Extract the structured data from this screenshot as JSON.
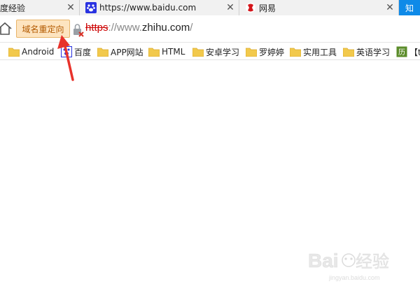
{
  "tabs": [
    {
      "title": "度经验",
      "close": "✕"
    },
    {
      "title": "https://www.baidu.com",
      "close": "✕"
    },
    {
      "title": "网易",
      "close": "✕"
    }
  ],
  "zhi_tab": {
    "label": "知"
  },
  "addressbar": {
    "redirect_label": "域名重定向",
    "url_protocol": "https",
    "url_sep": "://",
    "url_www": "www.",
    "url_domain": "zhihu.com",
    "url_path": "/"
  },
  "bookmarks": [
    {
      "label": "Android",
      "icon": "folder-icon"
    },
    {
      "label": "百度",
      "icon": "baidu-icon"
    },
    {
      "label": "APP网站",
      "icon": "folder-icon"
    },
    {
      "label": "HTML",
      "icon": "folder-icon"
    },
    {
      "label": "安卓学习",
      "icon": "folder-icon"
    },
    {
      "label": "罗婷婷",
      "icon": "folder-icon"
    },
    {
      "label": "实用工具",
      "icon": "folder-icon"
    },
    {
      "label": "英语学习",
      "icon": "folder-icon"
    },
    {
      "label": "【t",
      "icon": "calendar-icon"
    }
  ],
  "watermark": {
    "text": "Baidu经验",
    "subtext": "jingyan.baidu.com"
  },
  "colors": {
    "accent": "#0e8ae8",
    "redirect_bg": "#fde4c0",
    "arrow": "#e8322b",
    "protocol_error": "#c00000"
  }
}
